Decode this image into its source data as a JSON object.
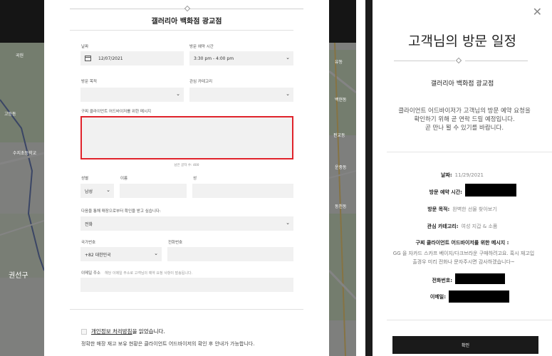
{
  "left": {
    "map": {
      "labels": [
        "곡헌",
        "유동",
        "백현동",
        "고등동",
        "판교동",
        "수지초등학교",
        "운중동",
        "동천동"
      ],
      "big_label": "권선구"
    },
    "modal": {
      "store_title": "갤러리아 백화점 광교점",
      "date_label": "날짜",
      "date_value": "12/07/2021",
      "time_label": "방문 예약 시간",
      "time_value": "3:30 pm - 4:00 pm",
      "purpose_label": "방문 목적",
      "category_label": "관심 카테고리",
      "message_label": "구찌 클라이언트 어드바이저를 위한 메시지",
      "counter_text": "남은 글자 수: 400",
      "title_label": "성별",
      "title_value": "남성",
      "first_name_label": "이름",
      "last_name_label": "성",
      "contact_label": "다음을 통해 매장으로부터 확인을 받고 싶습니다:",
      "contact_value": "전화",
      "country_label": "국가번호",
      "country_value": "+82 대한민국",
      "phone_label": "전화번호",
      "email_label": "이메일 주소",
      "email_hint": "해당 이메일 주소로 고객님의 예약 요청 사항이 발송됩니다.",
      "privacy_link": "개인정보 처리방침",
      "privacy_suffix": "을 읽었습니다.",
      "stock_note": "정확한 매장 재고 보유 현황은 클라이언트 어드바이저의 확인 후 안내가 가능합니다."
    }
  },
  "right": {
    "title": "고객님의 방문 일정",
    "store": "갤러리아 백화점 광교점",
    "description": [
      "클라이언트 어드바이저가 고객님의 방문 예약 요청을",
      "확인하기 위해 곧 연락 드릴 예정입니다.",
      "곧 만나 뵐 수 있기를 바랍니다."
    ],
    "date_key": "날짜:",
    "date_value": "11/29/2021",
    "time_key": "방문 예약 시간:",
    "purpose_key": "방문 목적:",
    "purpose_value": "완벽한 선물 찾아보기",
    "category_key": "관심 카테고리:",
    "category_value": "여성 지갑 & 소품",
    "message_key": "구찌 클라이언트 어드바이저를 위한 메시지 :",
    "message_body": [
      "GG 을 자카드 스카프 베이지/다크브라운 구매하려고요. 혹시 재고입",
      "출경우 미리 전화나 문자주시면 감사하겠습니다~"
    ],
    "phone_key": "전화번호:",
    "email_key": "이메일:",
    "confirm_label": "확인"
  }
}
